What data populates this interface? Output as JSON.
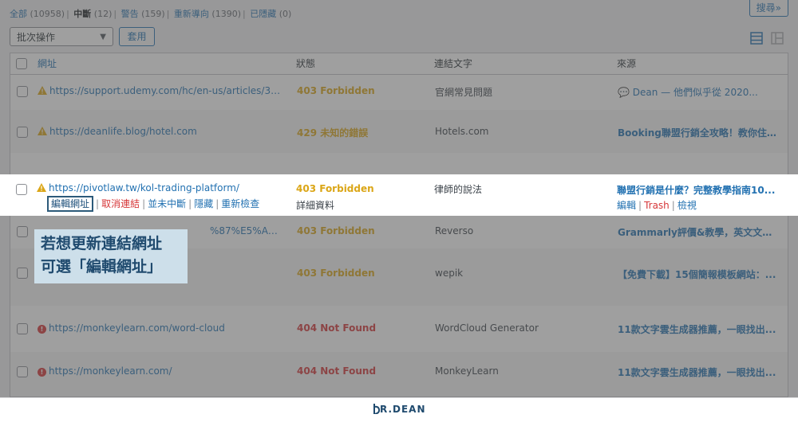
{
  "filters": {
    "all_label": "全部",
    "all_count": "(10958)",
    "broken_label": "中斷",
    "broken_count": "(12)",
    "warning_label": "警告",
    "warning_count": "(159)",
    "redirect_label": "重新導向",
    "redirect_count": "(1390)",
    "hidden_label": "已隱藏",
    "hidden_count": "(0)"
  },
  "search_button": "搜尋»",
  "bulk_actions": {
    "selected": "批次操作",
    "apply_label": "套用"
  },
  "columns": {
    "url": "網址",
    "status": "狀態",
    "anchor": "連結文字",
    "source": "來源"
  },
  "rows": [
    {
      "url": "https://support.udemy.com/hc/en-us/articles/360041...",
      "status": "403 Forbidden",
      "anchor": "官網常見問題",
      "source": "Dean — 他們似乎從 2020..."
    },
    {
      "url": "https://deanlife.blog/hotel.com",
      "status": "429 未知的錯誤",
      "anchor": "Hotels.com",
      "source": "Booking聯盟行銷全攻略！教你住..."
    },
    {
      "url": "https://pivotlaw.tw/kol-trading-platform/",
      "status": "403 Forbidden",
      "anchor": "律師的說法",
      "source": "聯盟行銷是什麼？完整教學指南10...",
      "details": "詳細資料",
      "actions": [
        "編輯網址",
        "取消連結",
        "並未中斷",
        "隱藏",
        "重新檢查"
      ],
      "source_actions": [
        "編輯",
        "Trash",
        "檢視"
      ]
    },
    {
      "url": "%87%E5%AD%97%...",
      "status": "403 Forbidden",
      "anchor": "Reverso",
      "source": "Grammarly評價&教學，英文文法..."
    },
    {
      "url": "",
      "status": "403 Forbidden",
      "anchor": "wepik",
      "source": "【免費下載】15個簡報模板網站：..."
    },
    {
      "url": "https://monkeylearn.com/word-cloud",
      "status": "404 Not Found",
      "anchor": "WordCloud Generator",
      "source": "11款文字雲生成器推薦，一眼找出..."
    },
    {
      "url": "https://monkeylearn.com/",
      "status": "404 Not Found",
      "anchor": "MonkeyLearn",
      "source": "11款文字雲生成器推薦，一眼找出..."
    }
  ],
  "callout": {
    "line1": "若想更新連結網址",
    "line2": "可選「編輯網址」"
  },
  "brand": "R.DEAN",
  "colors": {
    "link": "#2271b1",
    "warning": "#dba617",
    "error": "#d63638",
    "callout_bg": "#cddfea"
  }
}
